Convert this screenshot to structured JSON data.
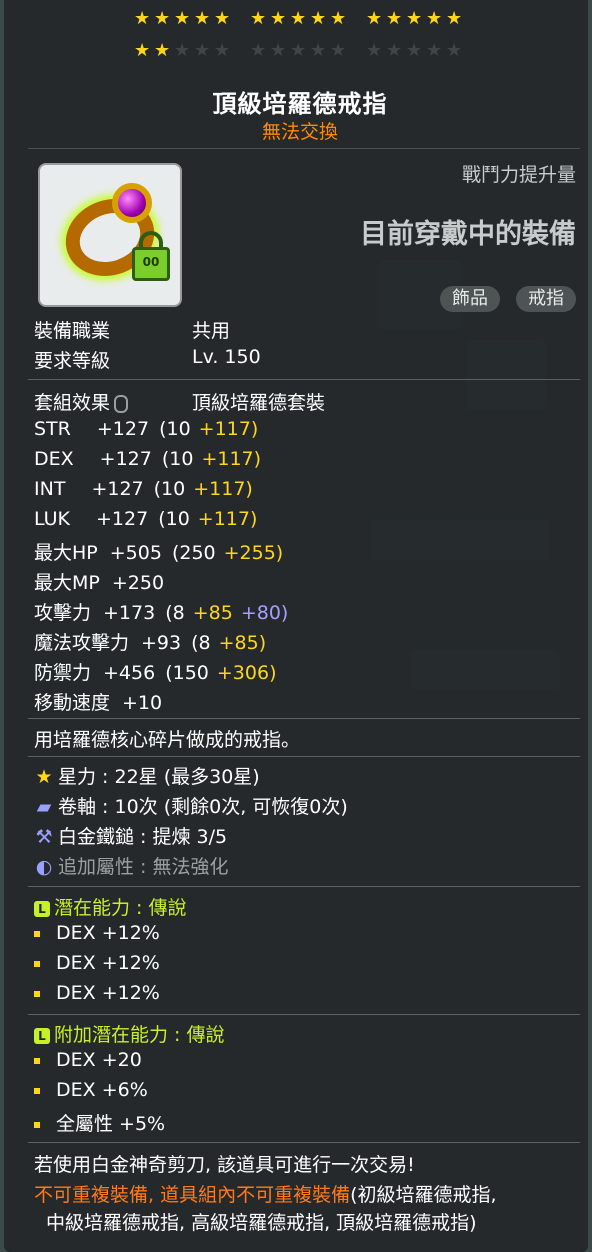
{
  "item": {
    "name": "頂級培羅德戒指",
    "trade_status": "無法交換",
    "stars": {
      "filled": 17,
      "total": 30
    },
    "power_label": "戰鬥力提升量",
    "equipped_label": "目前穿戴中的裝備",
    "tags": [
      "飾品",
      "戒指"
    ],
    "lock_text": "00"
  },
  "reqs": {
    "job_label": "裝備職業",
    "job_value": "共用",
    "level_label": "要求等級",
    "level_value": "Lv. 150"
  },
  "set": {
    "label": "套組效果",
    "value": "頂級培羅德套裝"
  },
  "stats": [
    {
      "name": "STR",
      "total": "+127",
      "base": "(10",
      "bonus1": "+117)",
      "bonus2": ""
    },
    {
      "name": "DEX",
      "total": "+127",
      "base": "(10",
      "bonus1": "+117)",
      "bonus2": ""
    },
    {
      "name": "INT",
      "total": "+127",
      "base": "(10",
      "bonus1": "+117)",
      "bonus2": ""
    },
    {
      "name": "LUK",
      "total": "+127",
      "base": "(10",
      "bonus1": "+117)",
      "bonus2": ""
    },
    {
      "name": "最大HP",
      "total": "+505",
      "base": "(250",
      "bonus1": "+255)",
      "bonus2": ""
    },
    {
      "name": "最大MP",
      "total": "+250",
      "base": "",
      "bonus1": "",
      "bonus2": ""
    },
    {
      "name": "攻擊力",
      "total": "+173",
      "base": "(8",
      "bonus1": "+85",
      "bonus2": "+80)"
    },
    {
      "name": "魔法攻擊力",
      "total": "+93",
      "base": "(8",
      "bonus1": "+85)",
      "bonus2": ""
    },
    {
      "name": "防禦力",
      "total": "+456",
      "base": "(150",
      "bonus1": "+306)",
      "bonus2": ""
    },
    {
      "name": "移動速度",
      "total": "+10",
      "base": "",
      "bonus1": "",
      "bonus2": ""
    }
  ],
  "description": "用培羅德核心碎片做成的戒指。",
  "upgrades": [
    {
      "icon": "star-icon",
      "glyph": "★",
      "text": "星力 : 22星 (最多30星)",
      "dim": false
    },
    {
      "icon": "scroll-icon",
      "glyph": "▰",
      "text": "卷軸 : 10次 (剩餘0次, 可恢復0次)",
      "dim": false
    },
    {
      "icon": "hammer-icon",
      "glyph": "⚒",
      "text": "白金鐵鎚 : 提煉 3/5",
      "dim": false
    },
    {
      "icon": "flame-icon",
      "glyph": "◐",
      "text": "追加屬性 : 無法強化",
      "dim": true
    }
  ],
  "potential": {
    "badge": "L",
    "title": "潛在能力 : 傳說",
    "lines": [
      "DEX +12%",
      "DEX +12%",
      "DEX +12%"
    ]
  },
  "bonus_potential": {
    "badge": "L",
    "title": "附加潛在能力 : 傳說",
    "lines": [
      "DEX +20",
      "DEX +6%",
      "全屬性 +5%"
    ]
  },
  "footer": {
    "scissors": "若使用白金神奇剪刀, 該道具可進行一次交易!",
    "unique_orange": "不可重複裝備, 道具組內不可重複裝備",
    "unique_white1": "(初級培羅德戒指,",
    "unique_white2": "中級培羅德戒指, 高級培羅德戒指, 頂級培羅德戒指)"
  },
  "colors": {
    "star": "#ffd61a",
    "orange": "#ff8a00",
    "legendary": "#c8f02a",
    "blue": "#a6a0ff"
  }
}
